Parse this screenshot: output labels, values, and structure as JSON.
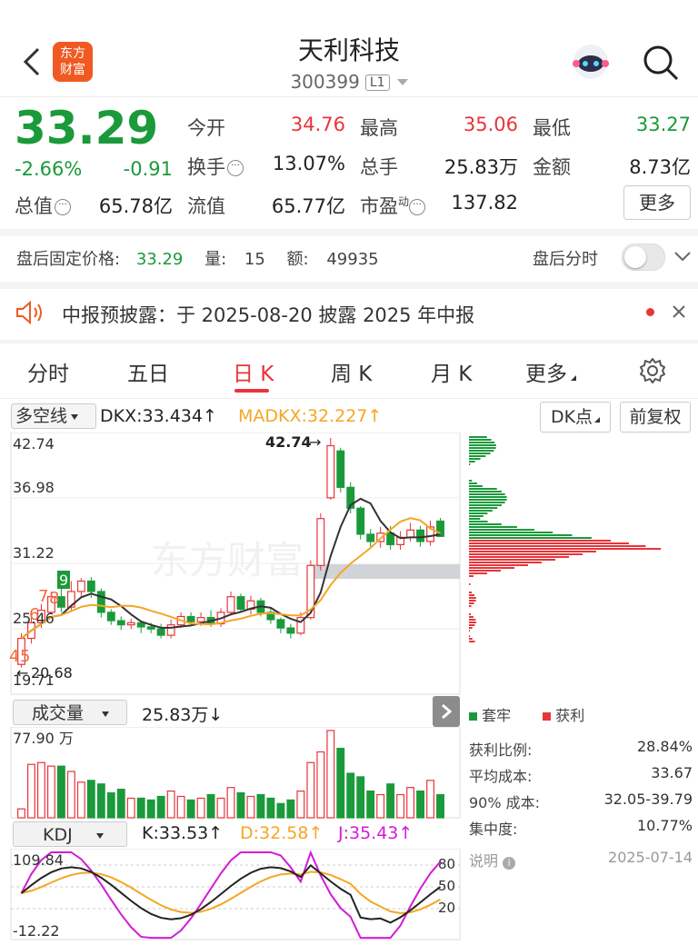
{
  "header": {
    "logo_text": "东方财富",
    "stock_name": "天利科技",
    "stock_code": "300399",
    "level_badge": "L1"
  },
  "quote": {
    "price": "33.29",
    "change_pct": "-2.66%",
    "change": "-0.91",
    "open_label": "今开",
    "open": "34.76",
    "high_label": "最高",
    "high": "35.06",
    "low_label": "最低",
    "low": "33.27",
    "turnover_label": "换手",
    "turnover": "13.07%",
    "volume_label": "总手",
    "volume": "25.83万",
    "amount_label": "金额",
    "amount": "8.73亿",
    "mktcap_label": "总值",
    "mktcap": "65.78亿",
    "float_label": "流值",
    "float": "65.77亿",
    "pe_label": "市盈",
    "pe_sup": "动",
    "pe": "137.82",
    "more_label": "更多"
  },
  "after_hours": {
    "price_label": "盘后固定价格:",
    "price": "33.29",
    "vol_label": "量:",
    "vol": "15",
    "amt_label": "额:",
    "amt": "49935",
    "timeshare_label": "盘后分时"
  },
  "notice": {
    "text": "中报预披露：于 2025-08-20 披露 2025 年中报"
  },
  "tabs": [
    "分时",
    "五日",
    "日 K",
    "周 K",
    "月 K",
    "更多"
  ],
  "active_tab": 2,
  "indicator_bar": {
    "selector": "多空线",
    "dkx": "DKX:33.434",
    "madkx": "MADKX:32.227",
    "dk_points": "DK点",
    "adjust": "前复权"
  },
  "kline": {
    "y_labels": [
      "42.74",
      "36.98",
      "31.22",
      "25.46",
      "19.71"
    ],
    "max_marker": "42.74",
    "min_marker": "20.68",
    "watermark": "东方财富",
    "seq_marks": [
      "4",
      "5",
      "6",
      "7",
      "8",
      "9"
    ]
  },
  "volume": {
    "selector": "成交量",
    "value": "25.83万",
    "y_max": "77.90 万"
  },
  "kdj": {
    "selector": "KDJ",
    "k": "K:33.53",
    "d": "D:32.58",
    "j": "J:35.43",
    "y_top": "109.84",
    "y_bottom": "-12.22",
    "levels": [
      "80",
      "50",
      "20"
    ]
  },
  "chips": {
    "legend_trapped": "套牢",
    "legend_profit": "获利",
    "stats": [
      {
        "label": "获利比例:",
        "value": "28.84%"
      },
      {
        "label": "平均成本:",
        "value": "33.67"
      },
      {
        "label": "90% 成本:",
        "value": "32.05-39.79"
      },
      {
        "label": "集中度:",
        "value": "10.77%"
      }
    ],
    "note_label": "说明",
    "date": "2025-07-14"
  },
  "colors": {
    "up": "#e8343a",
    "down": "#1a9a3a",
    "accent": "#f5a623",
    "brand": "#f05a22"
  }
}
